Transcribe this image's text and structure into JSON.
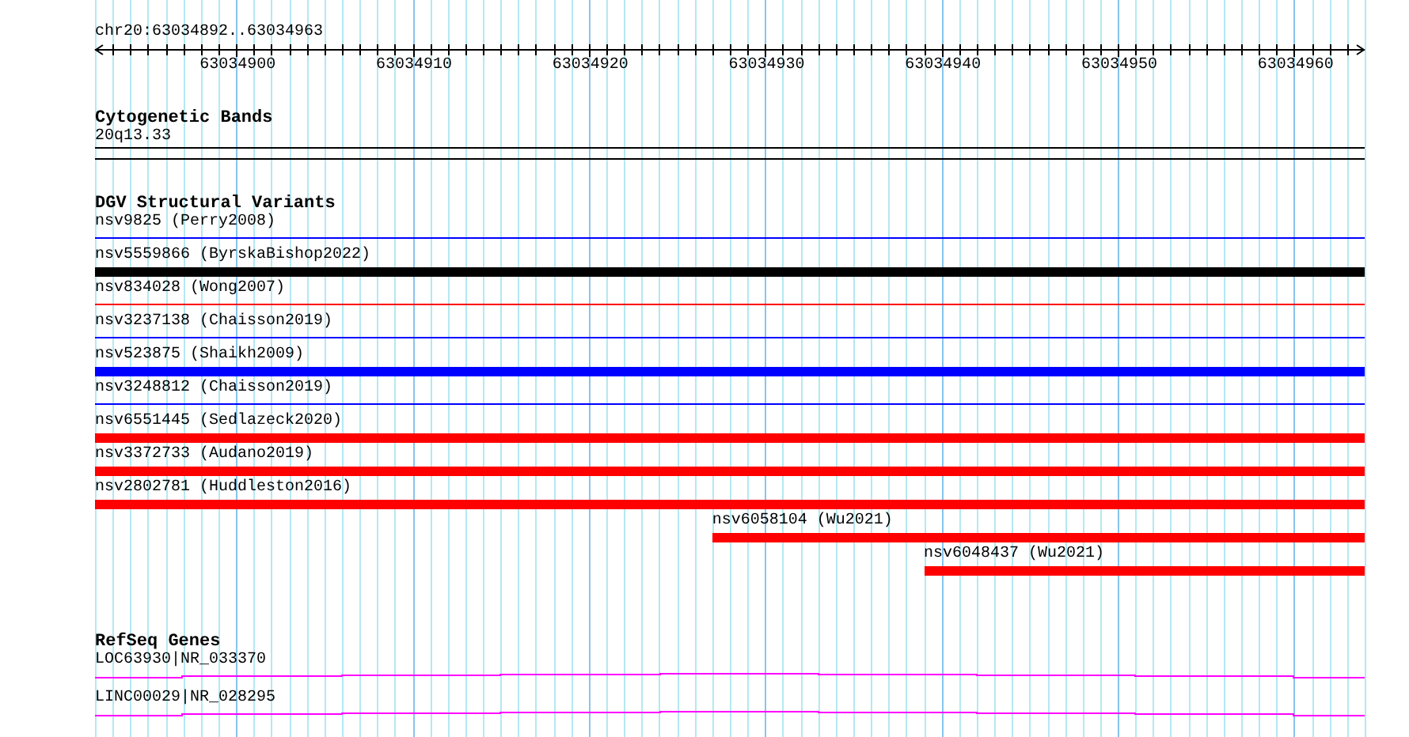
{
  "ruler": {
    "location": "chr20:63034892..63034963",
    "ticks": [
      "63034900",
      "63034910",
      "63034920",
      "63034930",
      "63034940",
      "63034950",
      "63034960"
    ]
  },
  "tracks": [
    {
      "kind": "bands",
      "title": "Cytogenetic Bands",
      "features": [
        {
          "label": "20q13.33"
        }
      ]
    },
    {
      "kind": "variants",
      "title": "DGV Structural Variants",
      "features": [
        {
          "label": "nsv9825 (Perry2008)",
          "kind": "thin",
          "color": "#0000ff"
        },
        {
          "label": "nsv5559866 (ByrskaBishop2022)",
          "kind": "thick",
          "color": "#000000"
        },
        {
          "label": "nsv834028 (Wong2007)",
          "kind": "thin",
          "color": "#ff0000"
        },
        {
          "label": "nsv3237138 (Chaisson2019)",
          "kind": "thin",
          "color": "#0000ff"
        },
        {
          "label": "nsv523875 (Shaikh2009)",
          "kind": "thick",
          "color": "#0000ff"
        },
        {
          "label": "nsv3248812 (Chaisson2019)",
          "kind": "thin",
          "color": "#0000ff"
        },
        {
          "label": "nsv6551445 (Sedlazeck2020)",
          "kind": "thick",
          "color": "#ff0000"
        },
        {
          "label": "nsv3372733 (Audano2019)",
          "kind": "thick",
          "color": "#ff0000"
        },
        {
          "label": "nsv2802781 (Huddleston2016)",
          "kind": "thick",
          "color": "#ff0000"
        },
        {
          "label": "nsv6058104 (Wu2021)",
          "kind": "thick",
          "color": "#ff0000"
        },
        {
          "label": "nsv6048437 (Wu2021)",
          "kind": "thick",
          "color": "#ff0000"
        }
      ]
    },
    {
      "kind": "genes",
      "title": "RefSeq Genes",
      "features": [
        {
          "label": "LOC63930|NR_033370"
        },
        {
          "label": "LINC00029|NR_028295"
        }
      ]
    }
  ]
}
